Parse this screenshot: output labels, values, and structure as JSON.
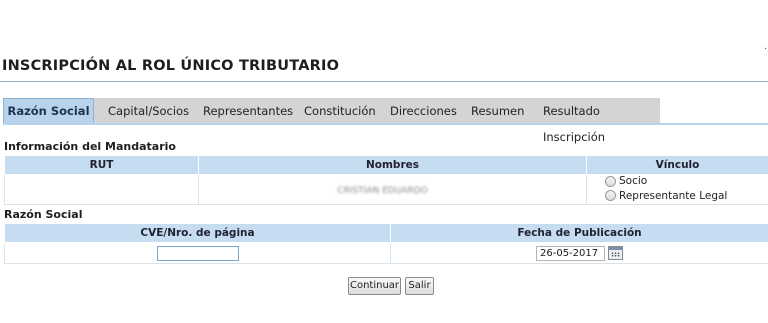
{
  "page": {
    "title": "INSCRIPCIÓN AL ROL ÚNICO TRIBUTARIO"
  },
  "tabs": [
    {
      "label": "Razón Social",
      "active": true
    },
    {
      "label": "Capital/Socios",
      "active": false
    },
    {
      "label": "Representantes",
      "active": false
    },
    {
      "label": "Constitución",
      "active": false
    },
    {
      "label": "Direcciones",
      "active": false
    },
    {
      "label": "Resumen",
      "active": false
    },
    {
      "label": "Resultado Inscripción",
      "active": false
    }
  ],
  "mandatario": {
    "section_title": "Información del Mandatario",
    "headers": {
      "rut": "RUT",
      "nombres": "Nombres",
      "vinculo": "Vínculo"
    },
    "row": {
      "rut": "",
      "nombres": "CRISTIAN EDUARDO",
      "vinculo_options": [
        "Socio",
        "Representante Legal"
      ]
    }
  },
  "razon_social": {
    "section_title": "Razón Social",
    "headers": {
      "cve": "CVE/Nro. de página",
      "fecha": "Fecha de Publicación"
    },
    "cve_value": "",
    "fecha_value": "26-05-2017"
  },
  "buttons": {
    "continuar": "Continuar",
    "salir": "Salir"
  },
  "colors": {
    "accent": "#b9d3ec",
    "header_bg": "#c6dcf0",
    "tab_bar": "#d4d4d4"
  }
}
